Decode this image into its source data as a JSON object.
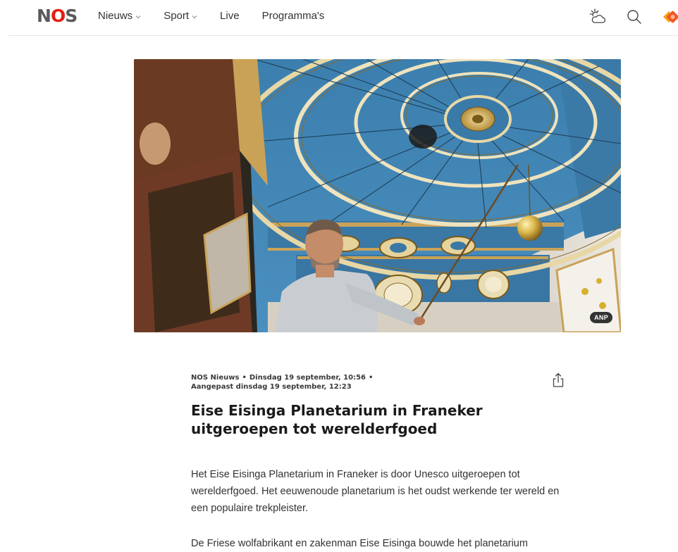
{
  "header": {
    "logo_n": "N",
    "logo_o": "O",
    "logo_s": "S",
    "nav": [
      {
        "label": "Nieuws",
        "has_dropdown": true
      },
      {
        "label": "Sport",
        "has_dropdown": true
      },
      {
        "label": "Live",
        "has_dropdown": false
      },
      {
        "label": "Programma's",
        "has_dropdown": false
      }
    ],
    "icons": [
      "weather-icon",
      "search-icon",
      "npo-start-icon"
    ]
  },
  "hero": {
    "credit": "ANP"
  },
  "article": {
    "source": "NOS Nieuws",
    "date": "Dinsdag 19 september, 10:56",
    "updated": "Aangepast dinsdag 19 september, 12:23",
    "title": "Eise Eisinga Planetarium in Franeker uitgeroepen tot werelderfgoed",
    "paragraphs": [
      "Het Eise Eisinga Planetarium in Franeker is door Unesco uitgeroepen tot werelderfgoed. Het eeuwenoude planetarium is het oudst werkende ter wereld en een populaire trekpleister.",
      "De Friese wolfabrikant en zakenman Eise Eisinga bouwde het planetarium"
    ]
  },
  "colors": {
    "brand_red": "#e61e14",
    "logo_grey": "#5a5a5a",
    "ceiling_blue": "#3f86b8"
  }
}
